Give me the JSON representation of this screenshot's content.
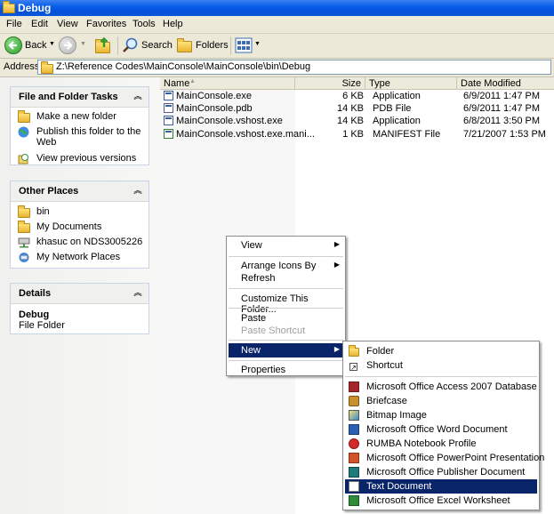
{
  "window": {
    "title": "Debug"
  },
  "menubar": {
    "items": [
      "File",
      "Edit",
      "View",
      "Favorites",
      "Tools",
      "Help"
    ]
  },
  "toolbar": {
    "back_label": "Back",
    "search_label": "Search",
    "folders_label": "Folders"
  },
  "address": {
    "label": "Address",
    "path": "Z:\\Reference Codes\\MainConsole\\MainConsole\\bin\\Debug"
  },
  "tasks": {
    "title": "File and Folder Tasks",
    "items": [
      "Make a new folder",
      "Publish this folder to the",
      "Web",
      "View previous versions"
    ]
  },
  "places": {
    "title": "Other Places",
    "items": [
      "bin",
      "My Documents",
      "khasuc on NDS3005226",
      "My Network Places"
    ]
  },
  "details": {
    "title": "Details",
    "name": "Debug",
    "type": "File Folder"
  },
  "columns": [
    "Name",
    "Size",
    "Type",
    "Date Modified"
  ],
  "files": [
    {
      "name": "MainConsole.exe",
      "size": "6 KB",
      "type": "Application",
      "date": "6/9/2011 1:47 PM"
    },
    {
      "name": "MainConsole.pdb",
      "size": "14 KB",
      "type": "PDB File",
      "date": "6/9/2011 1:47 PM"
    },
    {
      "name": "MainConsole.vshost.exe",
      "size": "14 KB",
      "type": "Application",
      "date": "6/8/2011 3:50 PM"
    },
    {
      "name": "MainConsole.vshost.exe.mani...",
      "size": "1 KB",
      "type": "MANIFEST File",
      "date": "7/21/2007 1:53 PM"
    }
  ],
  "context_menu": {
    "view": "View",
    "arrange": "Arrange Icons By",
    "refresh": "Refresh",
    "customize": "Customize This Folder...",
    "paste": "Paste",
    "paste_shortcut": "Paste Shortcut",
    "new": "New",
    "properties": "Properties"
  },
  "new_submenu": {
    "folder": "Folder",
    "shortcut": "Shortcut",
    "items": [
      "Microsoft Office Access 2007 Database",
      "Briefcase",
      "Bitmap Image",
      "Microsoft Office Word Document",
      "RUMBA Notebook Profile",
      "Microsoft Office PowerPoint Presentation",
      "Microsoft Office Publisher Document",
      "Text Document",
      "Microsoft Office Excel Worksheet"
    ]
  },
  "colors": {
    "titlebar": "#0a5ee8",
    "highlight": "#0a246a",
    "chrome": "#ece9d8"
  }
}
